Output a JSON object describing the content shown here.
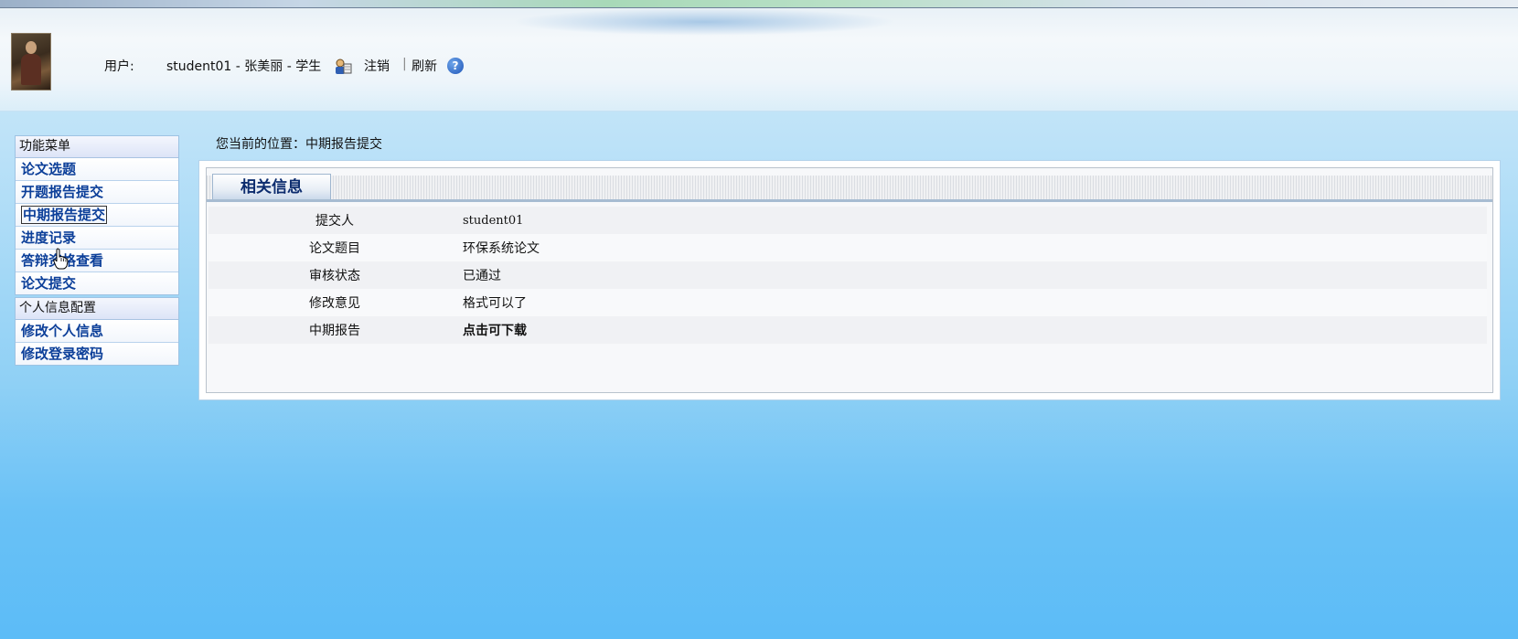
{
  "header": {
    "user_label": "用户:",
    "user_info": "student01 - 张美丽 - 学生",
    "logout": "注销",
    "separator": "|",
    "refresh": "刷新",
    "help": "?"
  },
  "sidebar": {
    "groups": [
      {
        "title": "功能菜单",
        "items": [
          {
            "label": "论文选题"
          },
          {
            "label": "开题报告提交"
          },
          {
            "label": "中期报告提交"
          },
          {
            "label": "进度记录"
          },
          {
            "label": "答辩资格查看"
          },
          {
            "label": "论文提交"
          }
        ]
      },
      {
        "title": "个人信息配置",
        "items": [
          {
            "label": "修改个人信息"
          },
          {
            "label": "修改登录密码"
          }
        ]
      }
    ]
  },
  "breadcrumb": "您当前的位置：中期报告提交",
  "panel": {
    "title": "相关信息",
    "rows": [
      {
        "label": "提交人",
        "value": "student01"
      },
      {
        "label": "论文题目",
        "value": "环保系统论文"
      },
      {
        "label": "审核状态",
        "value": "已通过"
      },
      {
        "label": "修改意见",
        "value": "格式可以了"
      },
      {
        "label": "中期报告",
        "value": "点击可下载"
      }
    ]
  }
}
